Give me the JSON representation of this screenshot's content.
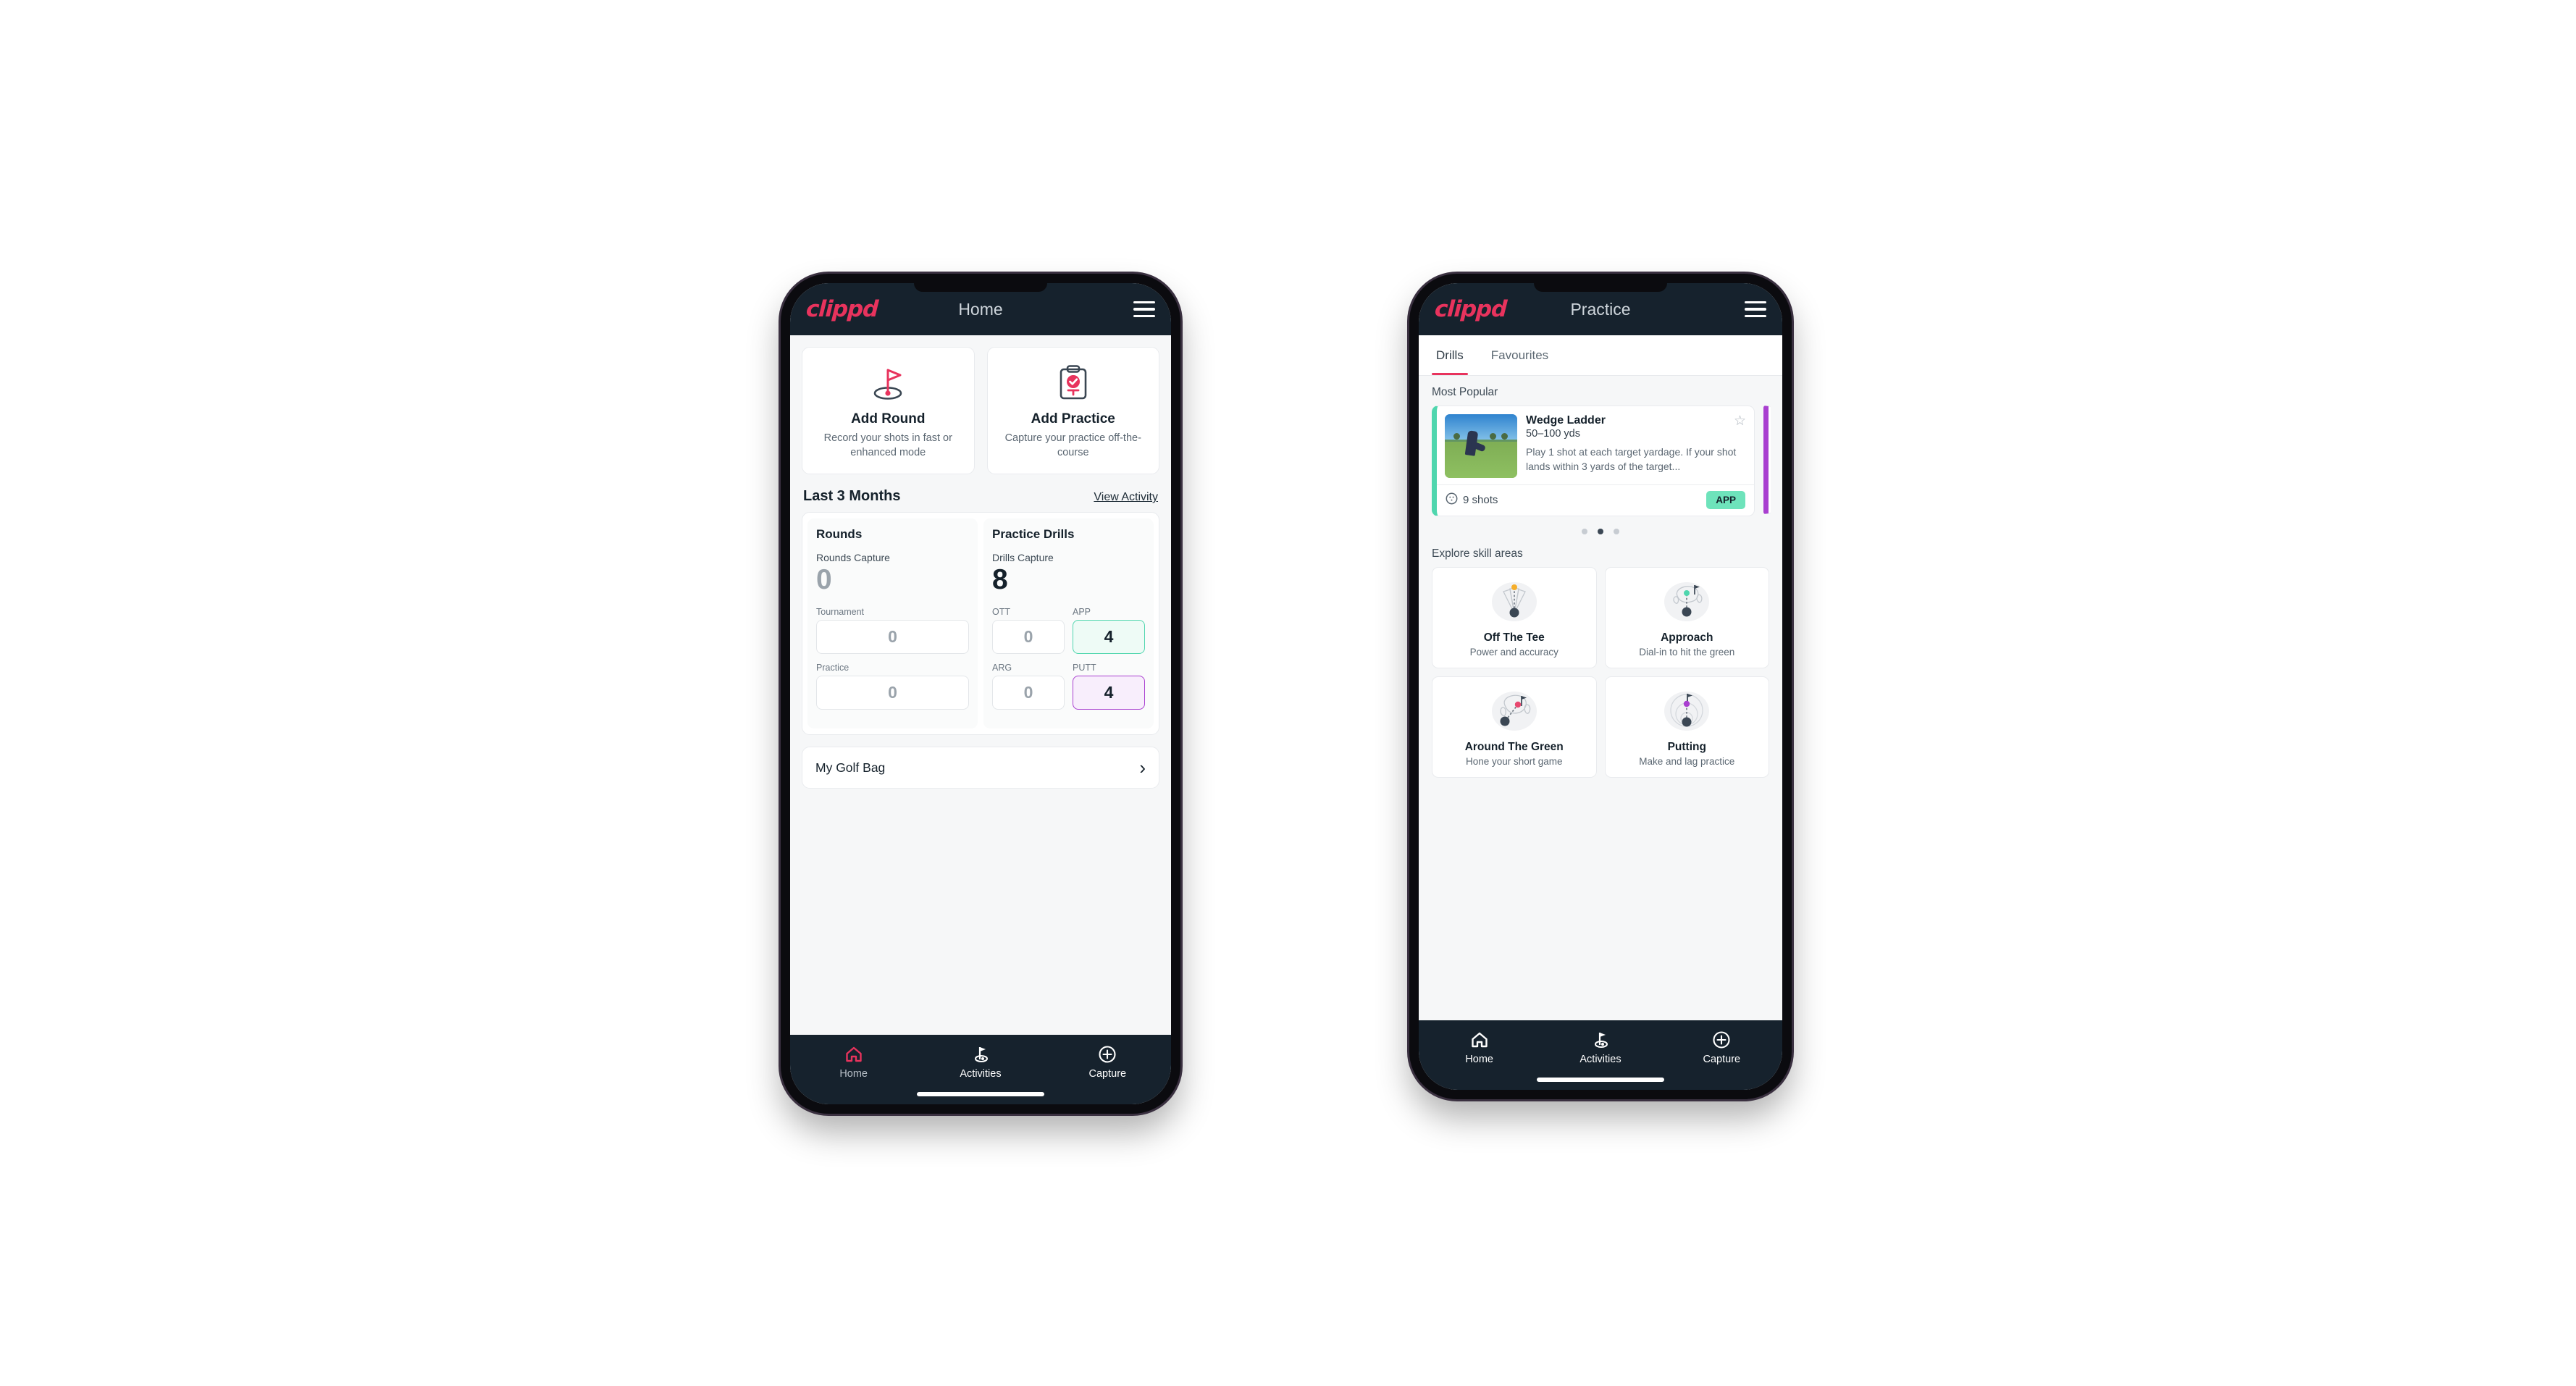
{
  "theme": {
    "brand_pink": "#e8335d",
    "header_navy": "#16222d",
    "accent_teal": "#4fd6ae",
    "accent_purple": "#a93fd0",
    "badge_teal": "#6ee3bb"
  },
  "phone_home": {
    "appbar": {
      "logo": "clippd",
      "title": "Home",
      "menu_icon": "hamburger-menu-icon"
    },
    "actions": [
      {
        "icon": "golf-flag-icon",
        "title": "Add Round",
        "subtitle": "Record your shots in fast or enhanced mode"
      },
      {
        "icon": "clipboard-check-icon",
        "title": "Add Practice",
        "subtitle": "Capture your practice off-the-course"
      }
    ],
    "section": {
      "title": "Last 3 Months",
      "link": "View Activity"
    },
    "stats": {
      "rounds": {
        "heading": "Rounds",
        "capture_label": "Rounds Capture",
        "capture_value": "0",
        "fields": [
          {
            "label": "Tournament",
            "value": "0",
            "style": "plain"
          },
          {
            "label": "Practice",
            "value": "0",
            "style": "plain"
          }
        ]
      },
      "drills": {
        "heading": "Practice Drills",
        "capture_label": "Drills Capture",
        "capture_value": "8",
        "fields": [
          {
            "label": "OTT",
            "value": "0",
            "style": "plain"
          },
          {
            "label": "APP",
            "value": "4",
            "style": "teal"
          },
          {
            "label": "ARG",
            "value": "0",
            "style": "plain"
          },
          {
            "label": "PUTT",
            "value": "4",
            "style": "purple"
          }
        ]
      }
    },
    "golf_bag": {
      "label": "My Golf Bag",
      "chevron": "chevron-right-icon"
    },
    "nav": [
      {
        "icon": "home-icon",
        "label": "Home",
        "active": true
      },
      {
        "icon": "golf-flag-nav-icon",
        "label": "Activities",
        "active": false
      },
      {
        "icon": "plus-circle-icon",
        "label": "Capture",
        "active": false
      }
    ]
  },
  "phone_practice": {
    "appbar": {
      "logo": "clippd",
      "title": "Practice",
      "menu_icon": "hamburger-menu-icon"
    },
    "tabs": [
      {
        "label": "Drills",
        "active": true
      },
      {
        "label": "Favourites",
        "active": false
      }
    ],
    "most_popular_heading": "Most Popular",
    "drill": {
      "name": "Wedge Ladder",
      "yardage": "50–100 yds",
      "description": "Play 1 shot at each target yardage. If your shot lands within 3 yards of the target...",
      "shots_icon": "golf-ball-icon",
      "shots": "9 shots",
      "badge": "APP",
      "favourite_icon": "star-outline-icon",
      "thumb_alt": "golfer-hitting-wedge-photo"
    },
    "carousel_dots": {
      "count": 3,
      "active_index": 1
    },
    "skill_heading": "Explore skill areas",
    "skills": [
      {
        "icon": "off-the-tee-icon",
        "title": "Off The Tee",
        "subtitle": "Power and accuracy"
      },
      {
        "icon": "approach-icon",
        "title": "Approach",
        "subtitle": "Dial-in to hit the green"
      },
      {
        "icon": "around-green-icon",
        "title": "Around The Green",
        "subtitle": "Hone your short game"
      },
      {
        "icon": "putting-icon",
        "title": "Putting",
        "subtitle": "Make and lag practice"
      }
    ],
    "nav": [
      {
        "icon": "home-icon",
        "label": "Home",
        "active": false
      },
      {
        "icon": "golf-flag-nav-icon",
        "label": "Activities",
        "active": true
      },
      {
        "icon": "plus-circle-icon",
        "label": "Capture",
        "active": false
      }
    ]
  }
}
